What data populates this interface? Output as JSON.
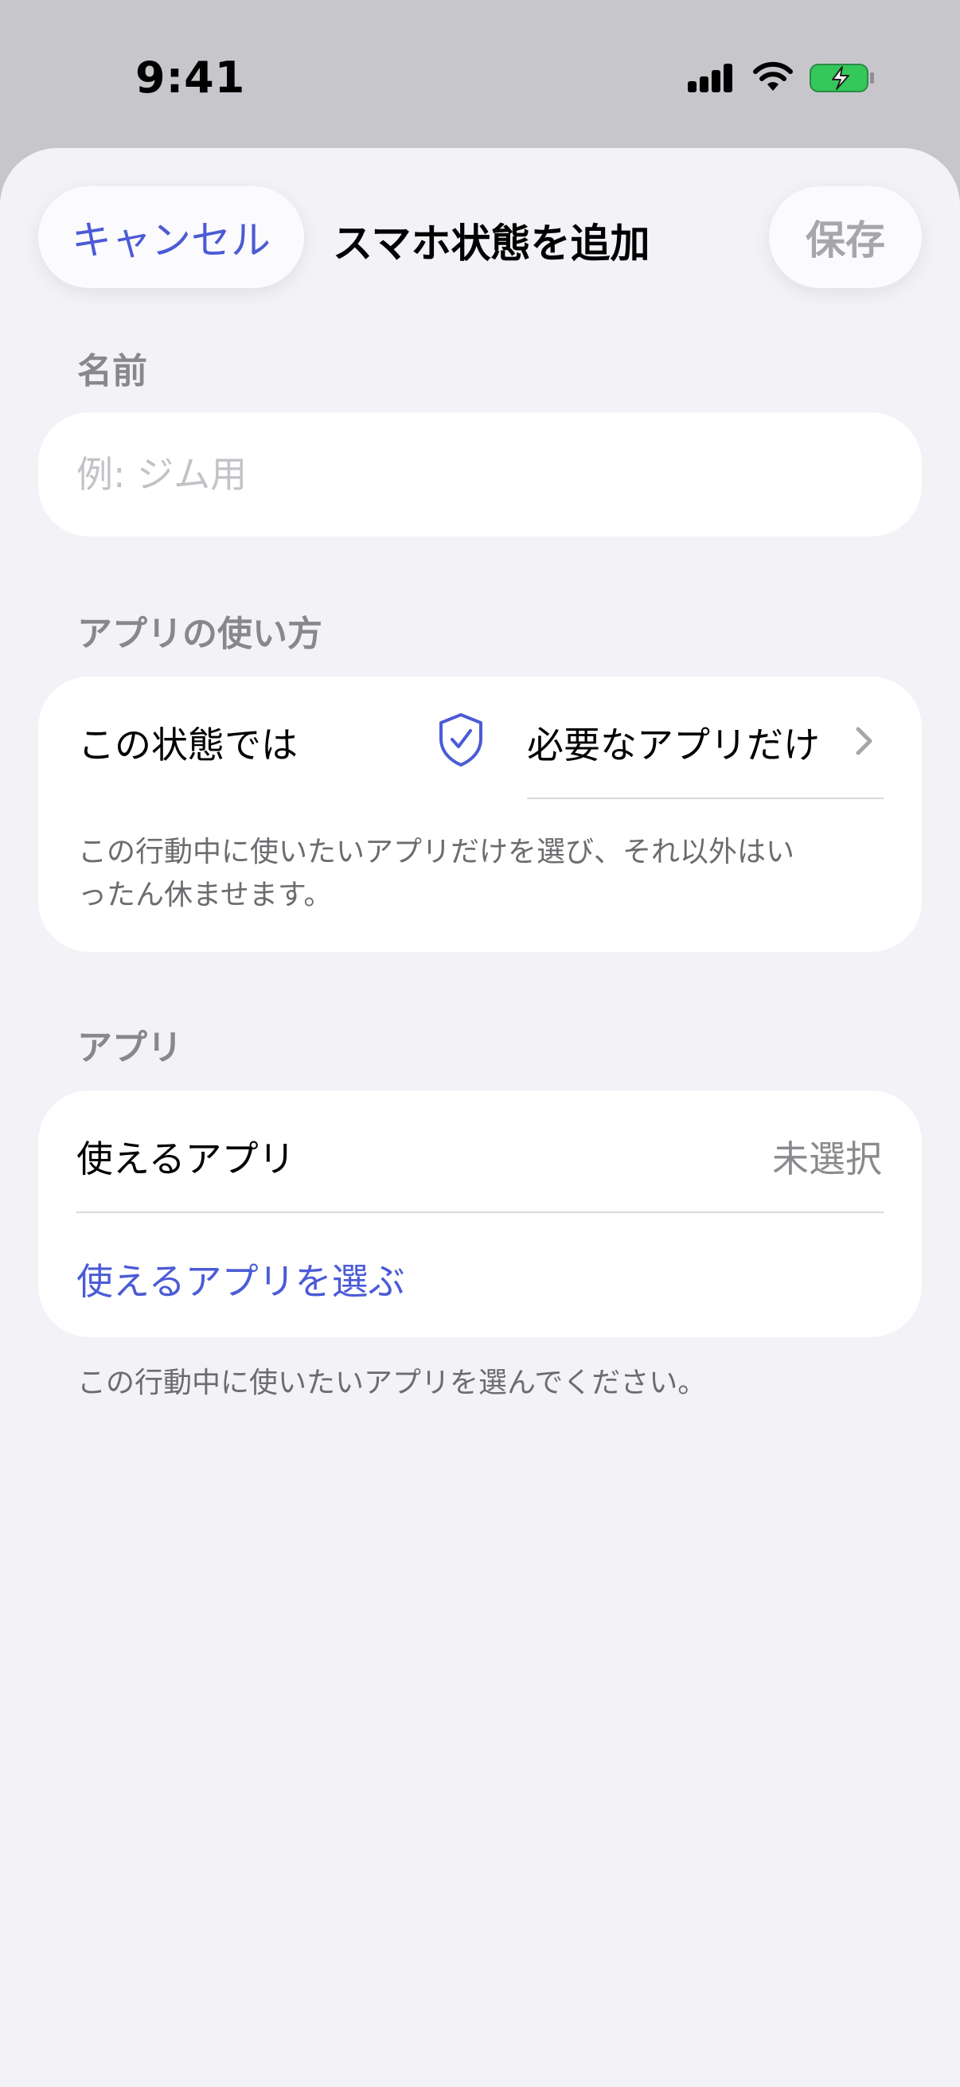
{
  "status_bar": {
    "time": "9:41",
    "icons": [
      "signal-icon",
      "wifi-icon",
      "battery-charging-icon"
    ],
    "battery_color": "#34c759"
  },
  "header": {
    "cancel_label": "キャンセル",
    "title": "スマホ状態を追加",
    "save_label": "保存"
  },
  "name_section": {
    "header": "名前",
    "placeholder": "例: ジム用",
    "value": ""
  },
  "usage_section": {
    "header": "アプリの使い方",
    "row_label": "この状態では",
    "row_icon": "shield-check-icon",
    "row_value": "必要なアプリだけ",
    "description": "この行動中に使いたいアプリだけを選び、それ以外はいったん休ませます。"
  },
  "apps_section": {
    "header": "アプリ",
    "row_label": "使えるアプリ",
    "row_value": "未選択",
    "choose_label": "使えるアプリを選ぶ",
    "footer": "この行動中に使いたいアプリを選んでください。"
  },
  "colors": {
    "accent": "#4b5bd6",
    "background": "#f2f2f7",
    "secondary_text": "#87878c"
  }
}
